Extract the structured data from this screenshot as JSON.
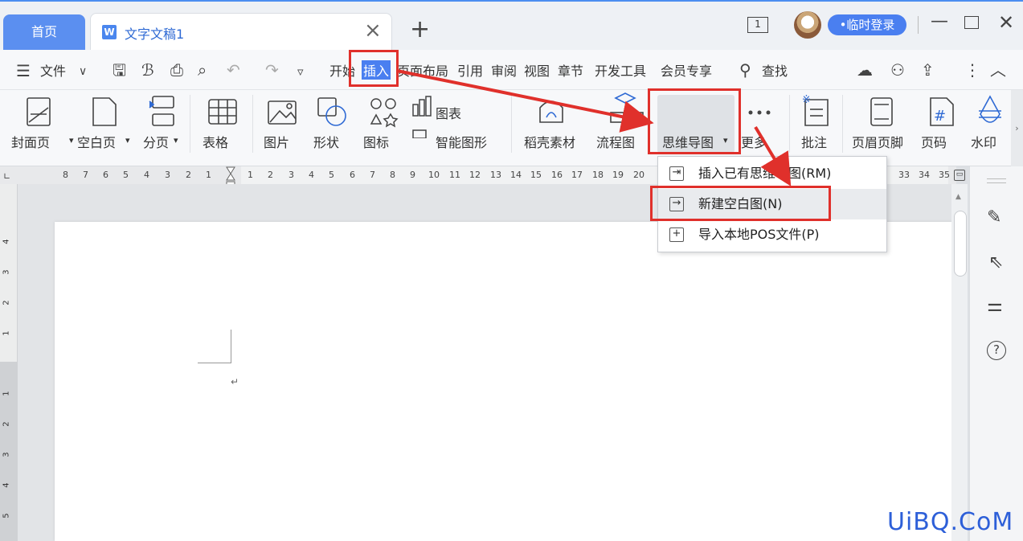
{
  "titlebar": {
    "home_tab": "首页",
    "doc_tab": "文字文稿1",
    "doc_icon_letter": "W",
    "window_count": "1",
    "login_label": "•临时登录"
  },
  "menubar": {
    "file": "文件",
    "items": [
      "开始",
      "插入",
      "页面布局",
      "引用",
      "审阅",
      "视图",
      "章节",
      "开发工具",
      "会员专享"
    ],
    "search": "查找"
  },
  "ribbon": {
    "buttons": [
      "封面页",
      "空白页",
      "分页",
      "表格",
      "图片",
      "形状",
      "图标",
      "稻壳素材",
      "流程图",
      "思维导图",
      "更多",
      "批注",
      "页眉页脚",
      "页码",
      "水印"
    ],
    "chart": "图表",
    "smart_shape": "智能图形"
  },
  "ruler": {
    "left_numbers": [
      "8",
      "7",
      "6",
      "5",
      "4",
      "3",
      "2",
      "1"
    ],
    "right_numbers": [
      "1",
      "2",
      "3",
      "4",
      "5",
      "6",
      "7",
      "8",
      "9",
      "10",
      "11",
      "12",
      "13",
      "14",
      "15",
      "16",
      "17",
      "18",
      "19",
      "20"
    ],
    "end_numbers": [
      "33",
      "34",
      "35"
    ],
    "vertical_numbers": [
      "4",
      "3",
      "2",
      "1",
      "1",
      "2",
      "3",
      "4",
      "5"
    ]
  },
  "dropdown": {
    "items": [
      "插入已有思维导图(RM)",
      "新建空白图(N)",
      "导入本地POS文件(P)"
    ]
  },
  "watermark": "UiBQ.CoM",
  "colors": {
    "accent": "#4a7ff0",
    "annotation": "#e0302b"
  }
}
